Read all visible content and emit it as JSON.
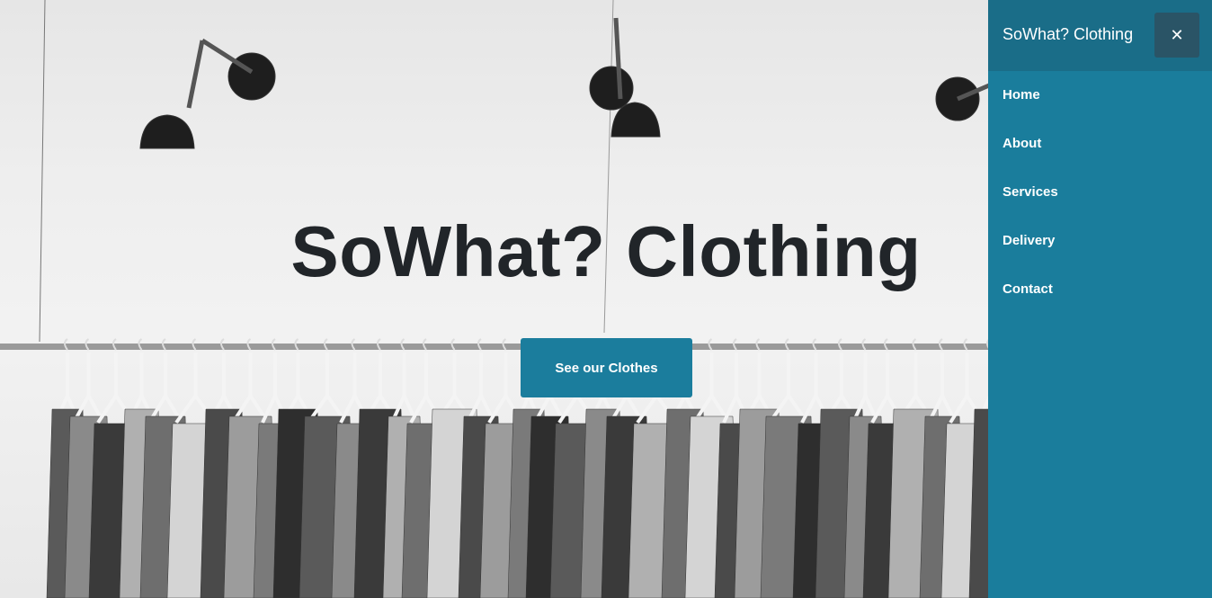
{
  "hero": {
    "title": "SoWhat? Clothing",
    "cta_label": "See our Clothes"
  },
  "sidebar": {
    "brand": "SoWhat? Clothing",
    "close_icon": "close-icon",
    "items": [
      {
        "label": "Home"
      },
      {
        "label": "About"
      },
      {
        "label": "Services"
      },
      {
        "label": "Delivery"
      },
      {
        "label": "Contact"
      }
    ]
  },
  "colors": {
    "accent": "#1b7d9d",
    "sidebar_bg": "#1a7d9c",
    "sidebar_header_bg": "#1a6d88",
    "title": "#212529"
  }
}
